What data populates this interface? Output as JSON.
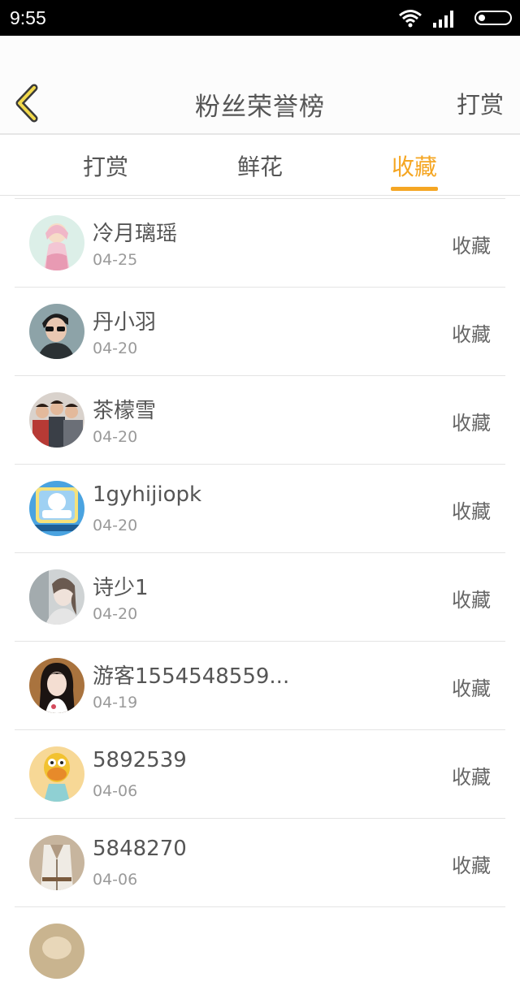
{
  "status_bar": {
    "time": "9:55"
  },
  "header": {
    "title": "粉丝荣誉榜",
    "action_label": "打赏",
    "back_icon": "chevron-left-icon",
    "accent_color": "#f5a623"
  },
  "tabs": [
    {
      "label": "打赏",
      "active": false
    },
    {
      "label": "鲜花",
      "active": false
    },
    {
      "label": "收藏",
      "active": true
    }
  ],
  "list": [
    {
      "name": "冷月璃瑶",
      "date": "04-25",
      "action": "收藏"
    },
    {
      "name": "丹小羽",
      "date": "04-20",
      "action": "收藏"
    },
    {
      "name": "茶檬雪",
      "date": "04-20",
      "action": "收藏"
    },
    {
      "name": "1gyhijiopk",
      "date": "04-20",
      "action": "收藏"
    },
    {
      "name": "诗少1",
      "date": "04-20",
      "action": "收藏"
    },
    {
      "name": "游客1554548559...",
      "date": "04-19",
      "action": "收藏"
    },
    {
      "name": "5892539",
      "date": "04-06",
      "action": "收藏"
    },
    {
      "name": "5848270",
      "date": "04-06",
      "action": "收藏"
    },
    {
      "name": "",
      "date": "",
      "action": ""
    }
  ]
}
